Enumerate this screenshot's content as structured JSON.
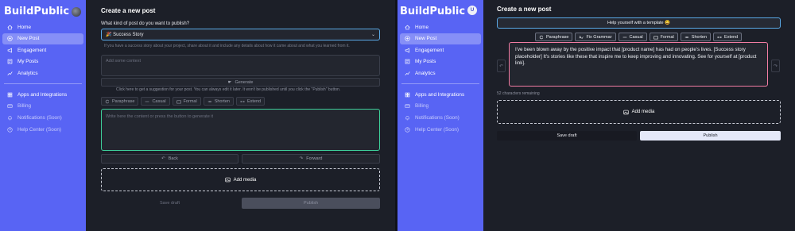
{
  "app": {
    "name": "BuildPublic"
  },
  "user": {
    "initial": "U"
  },
  "sidebar": {
    "main": [
      {
        "label": "Home",
        "icon": "home-icon"
      },
      {
        "label": "New Post",
        "icon": "plus-circle-icon"
      },
      {
        "label": "Engagement",
        "icon": "megaphone-icon"
      },
      {
        "label": "My Posts",
        "icon": "posts-icon"
      },
      {
        "label": "Analytics",
        "icon": "chart-icon"
      }
    ],
    "secondary": [
      {
        "label": "Apps and Integrations",
        "icon": "apps-icon"
      },
      {
        "label": "Billing",
        "icon": "billing-icon"
      },
      {
        "label": "Notifications (Soon)",
        "icon": "bell-icon"
      },
      {
        "label": "Help Center (Soon)",
        "icon": "help-icon"
      }
    ]
  },
  "left_form": {
    "title": "Create a new post",
    "post_type_label": "What kind of post do you want to publish?",
    "post_type_value": "🎉 Success Story",
    "post_type_hint": "If you have a success story about your project, share about it and include any details about how it came about and what you learned from it.",
    "context_placeholder": "Add some context",
    "generate_label": "Generate",
    "suggestion_note": "Click here to get a suggestion for your post. You can always edit it later. It won't be published until you click the \"Publish\" button.",
    "tools": [
      "Paraphrase",
      "Casual",
      "Formal",
      "Shorten",
      "Extend"
    ],
    "content_placeholder": "Write here the content or press the button to generate it",
    "back_label": "Back",
    "forward_label": "Forward",
    "add_media_label": "Add media",
    "save_draft_label": "Save draft",
    "publish_label": "Publish"
  },
  "right_form": {
    "title": "Create a new post",
    "template_button": "Help yourself with a template 😄",
    "tools": [
      "Paraphrase",
      "Fix Grammar",
      "Casual",
      "Formal",
      "Shorten",
      "Extend"
    ],
    "post_text": "I've been blown away by the positive impact that [product name] has had on people's lives. [Success story placeholder] It's stories like these that inspire me to keep improving and innovating. See for yourself at [product link].",
    "chars_remaining": "52 characters remaining",
    "add_media_label": "Add media",
    "save_draft_label": "Save draft",
    "publish_label": "Publish"
  },
  "colors": {
    "sidebar": "#5864f4",
    "panel": "#1c1f28",
    "accent_green": "#3ecf9a",
    "accent_pink": "#f27ca3",
    "accent_blue": "#5aa9e6"
  }
}
